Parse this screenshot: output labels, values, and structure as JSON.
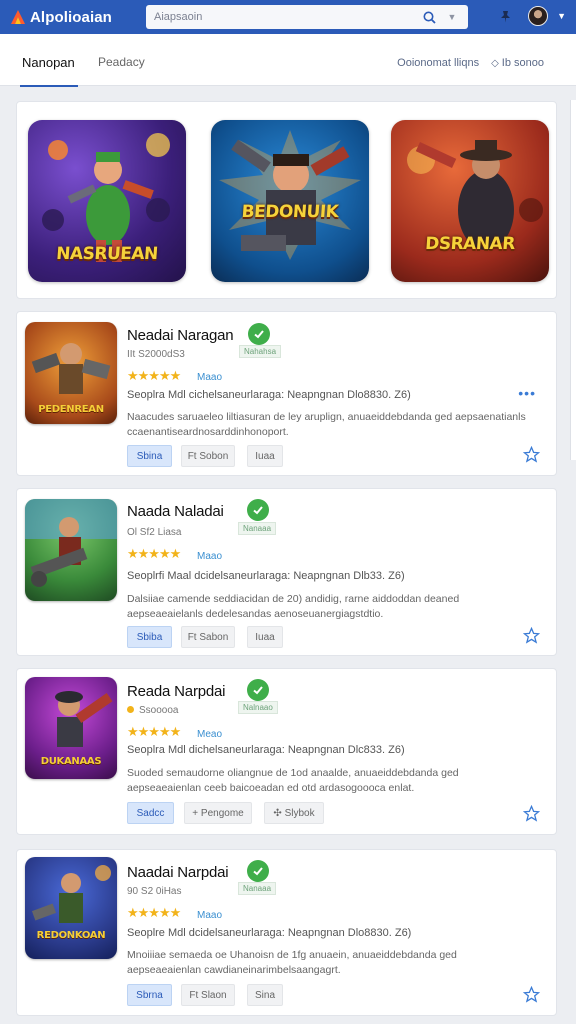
{
  "app": {
    "title": "Alpolioaian"
  },
  "search": {
    "placeholder": "Aiapsaoin"
  },
  "tabs": {
    "active": "Nanopan",
    "inactive": "Peadacy"
  },
  "links": {
    "left": "Ooionomat lliqns",
    "right": "Ib sonoo"
  },
  "colors": {
    "brand": "#2b5bb8",
    "star": "#f2b31a",
    "verified": "#3fae4a"
  },
  "featured": [
    {
      "title": "NASRUEAN",
      "bg": "#5b2fa0"
    },
    {
      "title": "BEDONUIK",
      "bg": "#1e72b5"
    },
    {
      "title": "DSRANAR",
      "bg": "#b53b23"
    }
  ],
  "cards": [
    {
      "thumb_label": "PEDENREAN",
      "title": "Neadai Naragan",
      "verified_label": "Nahahsa",
      "meta": "IIt S2000dS3",
      "stars": "★★★★★",
      "rating": "Maao",
      "subtitle": "Seoplra Mdl cichelsaneurlaraga: Neapngnan Dlo8830. Z6)",
      "desc": "Naacudes saruaeleo liltiasuran de ley aruplign, anuaeiddebdanda ged aepsaenatianls ccaenantiseardnosarddinhonoport.",
      "buttons": [
        "Sbina",
        "Ft Sobon",
        "Iuaa"
      ]
    },
    {
      "thumb_label": "",
      "title": "Naada Naladai",
      "verified_label": "Nanaaa",
      "meta": "Ol Sf2 Liasa",
      "stars": "★★★★★",
      "rating": "Maao",
      "subtitle": "Seoplrfi Maal dcidelsaneurlaraga: Neapngnan Dlb33. Z6)",
      "desc": "Dalsiiae camende seddiacidan de 20) andidig, rarne aiddoddan deaned aepseaeaielanls dedelesandas aenoseuanergiagstdtio.",
      "buttons": [
        "Sbiba",
        "Ft Sabon",
        "Iuaa"
      ]
    },
    {
      "thumb_label": "DUKANAAS",
      "title": "Reada Narpdai",
      "verified_label": "Nalnaao",
      "meta": "Ssooooa",
      "stars": "★★★★★",
      "rating": "Meao",
      "subtitle": "Seoplra Mdl dichelsaneurlaraga: Neapngnan Dlc833. Z6)",
      "desc": "Suoded semaudorne oliangnue de 1od anaalde, anuaeiddebdanda ged aepseaeaienlan ceeb baicoeadan ed otd ardasogoooca enlat.",
      "buttons": [
        "Sadcc",
        "Pengome",
        "Slybok"
      ]
    },
    {
      "thumb_label": "REDONKOAN",
      "title": "Naadai Narpdai",
      "verified_label": "Nanaaa",
      "meta": "90 S2 0iHas",
      "stars": "★★★★★",
      "rating": "Maao",
      "subtitle": "Seoplre Mdl dcidelsaneurlaraga: Neapngnan Dlo8830. Z6)",
      "desc": "Mnoiiiae semaeda oe Uhanoisn de 1fg anuaein, anuaeiddebdanda ged aepseaeaienlan cawdianeinarimbelsaangagrt.",
      "buttons": [
        "Sbrna",
        "Ft Slaon",
        "Sina"
      ]
    }
  ]
}
